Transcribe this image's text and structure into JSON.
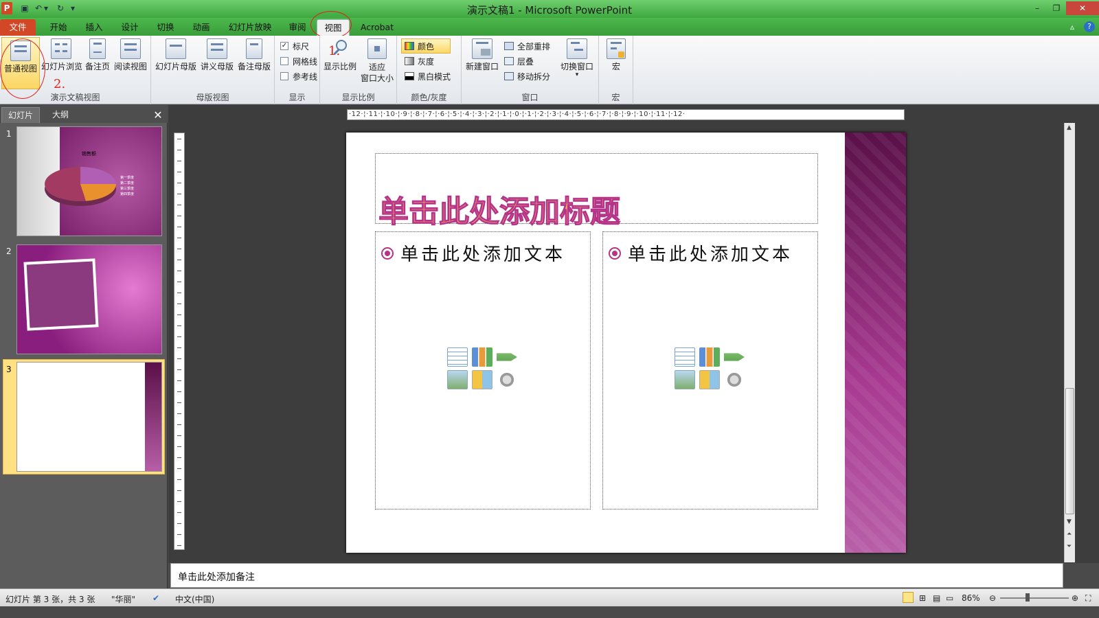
{
  "window": {
    "title": "演示文稿1 - Microsoft PowerPoint",
    "app_icon": "P"
  },
  "ribbon_tabs": [
    "文件",
    "开始",
    "插入",
    "设计",
    "切换",
    "动画",
    "幻灯片放映",
    "审阅",
    "视图",
    "Acrobat"
  ],
  "active_tab": "视图",
  "ribbon": {
    "presentation_views": {
      "label": "演示文稿视图",
      "buttons": [
        "普通视图",
        "幻灯片浏览",
        "备注页",
        "阅读视图"
      ]
    },
    "master_views": {
      "label": "母版视图",
      "buttons": [
        "幻灯片母版",
        "讲义母版",
        "备注母版"
      ]
    },
    "show": {
      "label": "显示",
      "items": [
        {
          "label": "标尺",
          "checked": true
        },
        {
          "label": "网格线",
          "checked": false
        },
        {
          "label": "参考线",
          "checked": false
        }
      ]
    },
    "zoom": {
      "label": "显示比例",
      "buttons": [
        "显示比例",
        "适应\n窗口大小"
      ]
    },
    "color": {
      "label": "颜色/灰度",
      "items": [
        "颜色",
        "灰度",
        "黑白模式"
      ]
    },
    "window": {
      "label": "窗口",
      "new_window": "新建窗口",
      "items": [
        "全部重排",
        "层叠",
        "移动拆分"
      ],
      "switch": "切换窗口"
    },
    "macros": {
      "label": "宏",
      "button": "宏"
    }
  },
  "annotations": {
    "one": "1.",
    "two": "2."
  },
  "panel": {
    "tab_slides": "幻灯片",
    "tab_outline": "大纲",
    "close": "✕",
    "slide_numbers": [
      "1",
      "2",
      "3"
    ],
    "thumb1_title": "销售额",
    "thumb1_legend": [
      "第一季度",
      "第二季度",
      "第三季度",
      "第四季度"
    ]
  },
  "ruler": {
    "horizontal": "·12·¦·11·¦·10·¦·9·¦·8·¦·7·¦·6·¦·5·¦·4·¦·3·¦·2·¦·1·¦·0·¦·1·¦·2·¦·3·¦·4·¦·5·¦·6·¦·7·¦·8·¦·9·¦·10·¦·11·¦·12·"
  },
  "slide": {
    "title_placeholder": "单击此处添加标题",
    "left_body": "单击此处添加文本",
    "right_body": "单击此处添加文本"
  },
  "notes_placeholder": "单击此处添加备注",
  "status": {
    "slide_info": "幻灯片 第 3 张，共 3 张",
    "theme": "\"华丽\"",
    "language": "中文(中国)",
    "zoom": "86%"
  }
}
